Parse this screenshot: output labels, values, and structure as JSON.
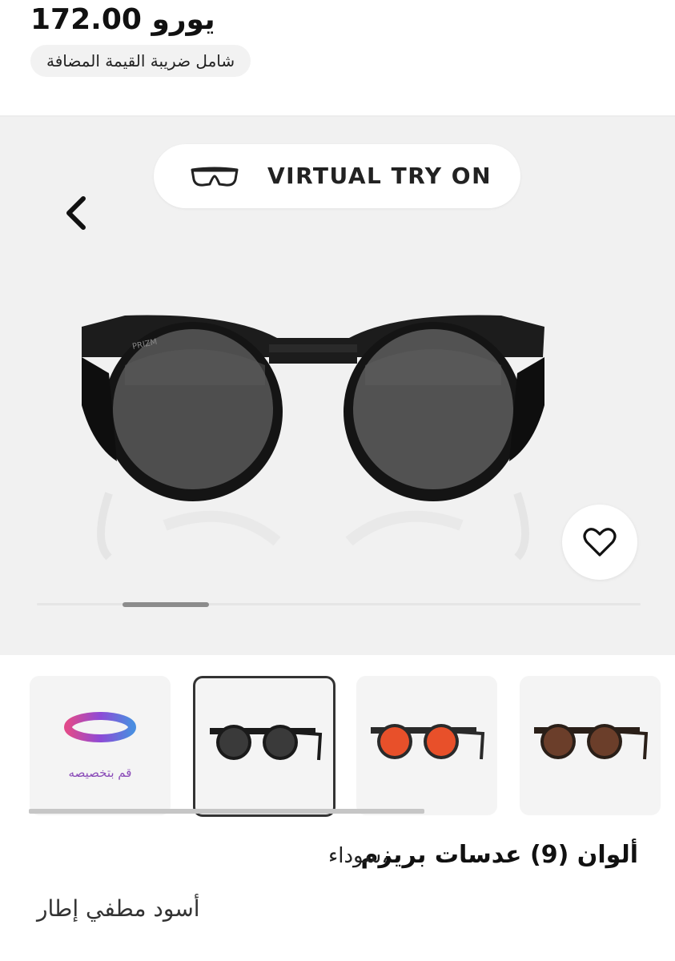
{
  "price": {
    "amount": "172.00 يورو",
    "vat_note": "شامل ضريبة القيمة المضافة"
  },
  "gallery": {
    "virtual_try_on_label": "VIRTUAL TRY ON",
    "back_icon": "chevron-left-icon",
    "wishlist_icon": "heart-icon",
    "carousel_position": 0.15
  },
  "swatches": [
    {
      "type": "customize",
      "label": "قم بتخصيصه",
      "selected": false
    },
    {
      "type": "variant",
      "lens_color": "#3a3a3a",
      "frame_color": "#1a1a1a",
      "selected": true
    },
    {
      "type": "variant",
      "lens_color": "#e8502a",
      "frame_color": "#2a2a2a",
      "selected": false
    },
    {
      "type": "variant",
      "lens_color": "#6b3e2a",
      "frame_color": "#2a1f18",
      "selected": false
    }
  ],
  "product": {
    "name": "ألوان (9) عدسات بريزم",
    "color": "،سوداء",
    "frame": "أسود مطفي إطار"
  },
  "colors": {
    "accent_purple": "#8a4bb8",
    "background_gallery": "#f1f1f1"
  }
}
